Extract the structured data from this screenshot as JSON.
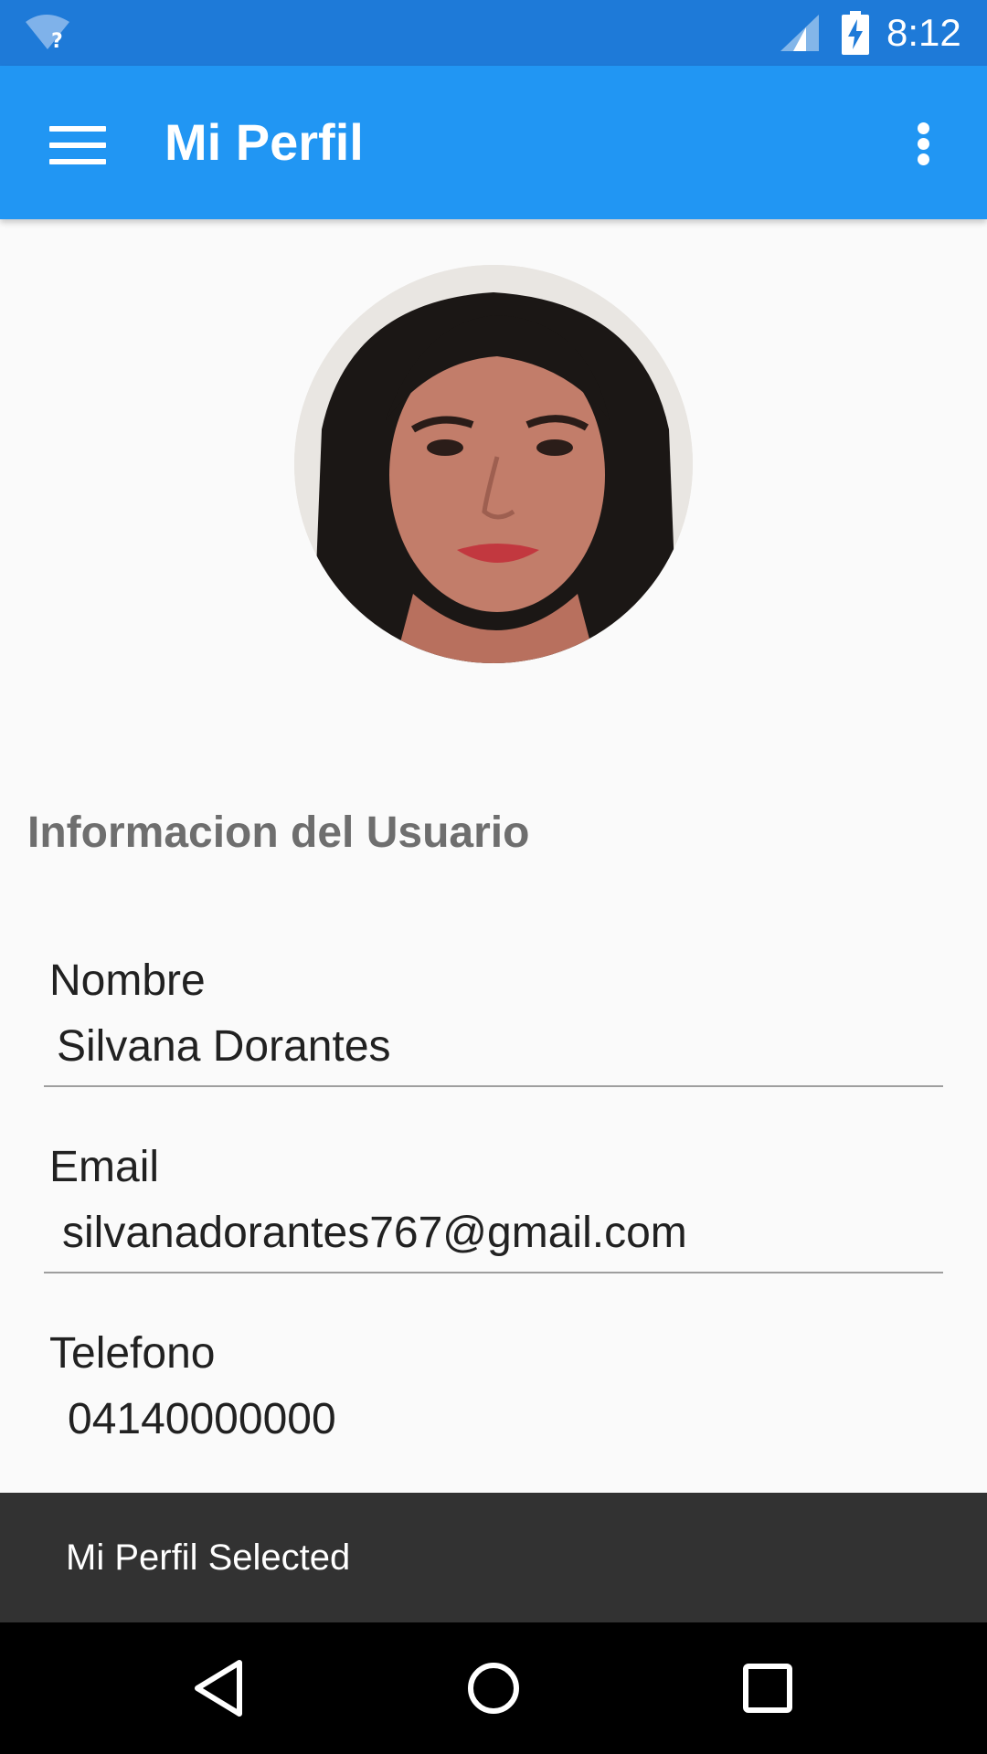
{
  "status_bar": {
    "time": "8:12",
    "icons": [
      "wifi-unknown-icon",
      "cellular-signal-icon",
      "battery-charging-icon"
    ]
  },
  "app_bar": {
    "title": "Mi Perfil",
    "color": "#2196f3",
    "menu_icon": "hamburger-menu-icon",
    "overflow_icon": "more-vert-icon"
  },
  "profile": {
    "avatar_icon": "profile-photo"
  },
  "section": {
    "title": "Informacion del Usuario"
  },
  "fields": [
    {
      "label": "Nombre",
      "value": "Silvana Dorantes"
    },
    {
      "label": "Email",
      "value": "silvanadorantes767@gmail.com"
    },
    {
      "label": "Telefono",
      "value": "04140000000"
    }
  ],
  "snackbar": {
    "text": "Mi Perfil Selected"
  },
  "nav_bar": {
    "icons": [
      "back-icon",
      "home-icon",
      "recents-icon"
    ]
  }
}
